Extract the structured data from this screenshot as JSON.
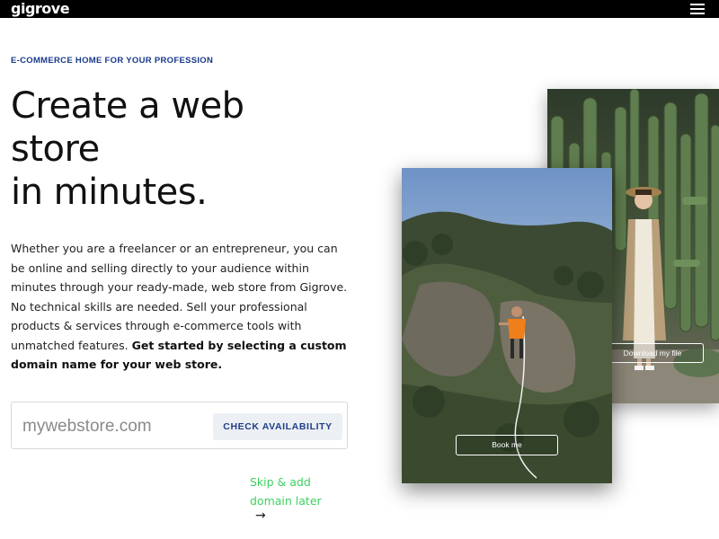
{
  "header": {
    "logo": "gigrove",
    "menu_icon": "hamburger-menu-icon"
  },
  "hero": {
    "eyebrow": "E-COMMERCE HOME FOR YOUR PROFESSION",
    "headline_lines": [
      "Create a web",
      "store",
      "in minutes."
    ],
    "body": "Whether you are a freelancer or an entrepreneur, you can be online and selling directly to your audience within minutes through your ready-made, web store from Gigrove. No technical skills are needed. Sell your professional products & services through e-commerce tools with unmatched features.",
    "body_bold": "Get started by selecting a custom domain name for your web store."
  },
  "domain_search": {
    "placeholder": "mywebstore.com",
    "button_label": "CHECK AVAILABILITY"
  },
  "skip": {
    "label": "Skip & add domain later",
    "arrow": "→"
  },
  "photos": {
    "back_button": "Download my file",
    "front_button": "Book me"
  },
  "colors": {
    "topbar": "#000000",
    "eyebrow": "#1a3a8a",
    "button_bg": "#eceff3",
    "button_text": "#1f3d8a",
    "skip_link": "#3cd05f"
  }
}
